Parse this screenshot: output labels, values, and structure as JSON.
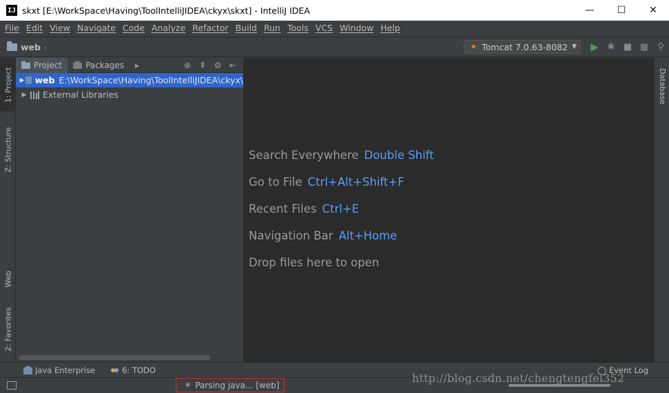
{
  "window": {
    "icon_text": "IJ",
    "title": "skxt [E:\\WorkSpace\\Having\\ToolIntelliJIDEA\\ckyx\\skxt] - IntelliJ IDEA",
    "minimize": "—",
    "maximize": "☐",
    "close": "✕"
  },
  "menu": [
    "File",
    "Edit",
    "View",
    "Navigate",
    "Code",
    "Analyze",
    "Refactor",
    "Build",
    "Run",
    "Tools",
    "VCS",
    "Window",
    "Help"
  ],
  "navbar": {
    "breadcrumb": "web",
    "run_config": "Tomcat 7.0.63-8082"
  },
  "left_stripe": {
    "project": "1: Project",
    "structure": "Z: Structure",
    "web": "Web",
    "favorites": "2: Favorites"
  },
  "project_panel": {
    "tabs": [
      "Project",
      "Packages"
    ],
    "tree": [
      {
        "name": "web",
        "path": "E:\\WorkSpace\\Having\\ToolIntelliJIDEA\\ckyx\\",
        "selected": true
      },
      {
        "name": "External Libraries",
        "path": "",
        "selected": false
      }
    ]
  },
  "editor_hints": [
    {
      "text": "Search Everywhere",
      "key": "Double Shift"
    },
    {
      "text": "Go to File",
      "key": "Ctrl+Alt+Shift+F"
    },
    {
      "text": "Recent Files",
      "key": "Ctrl+E"
    },
    {
      "text": "Navigation Bar",
      "key": "Alt+Home"
    },
    {
      "text": "Drop files here to open",
      "key": ""
    }
  ],
  "right_stripe": {
    "database": "Database"
  },
  "bottom_tools": {
    "java_enterprise": "Java Enterprise",
    "todo": "6: TODO",
    "event_log": "Event Log"
  },
  "status": {
    "message": "Parsing java... [web]",
    "watermark": "http://blog.csdn.net/chengtengfei352"
  },
  "colors": {
    "accent_key": "#589df6",
    "selection": "#2f65ca",
    "highlight_border": "#d9302e",
    "run_green": "#499c54"
  }
}
